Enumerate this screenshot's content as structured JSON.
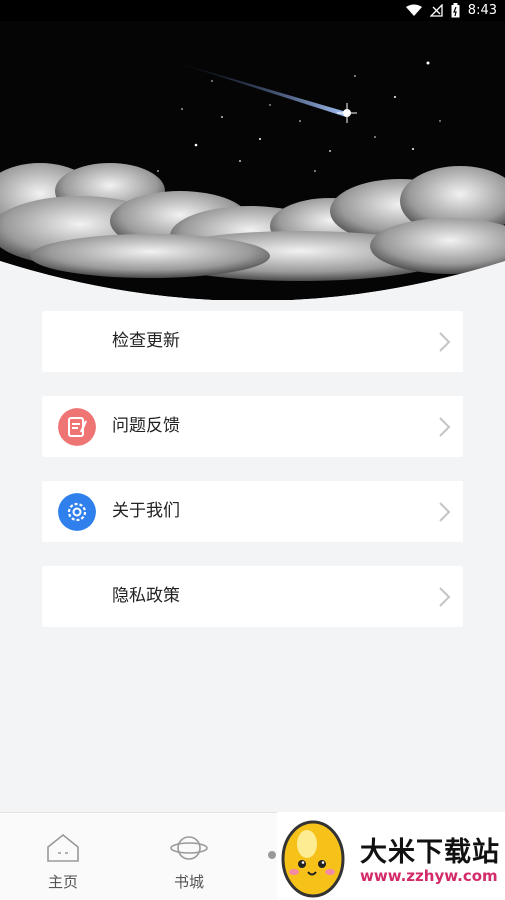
{
  "status_bar": {
    "time": "8:43"
  },
  "menu": {
    "items": [
      {
        "label": "检查更新",
        "icon": "none"
      },
      {
        "label": "问题反馈",
        "icon": "feedback-note-icon",
        "color": "#ef7474"
      },
      {
        "label": "关于我们",
        "icon": "gear-icon",
        "color": "#2f80ed"
      },
      {
        "label": "隐私政策",
        "icon": "none"
      }
    ]
  },
  "bottom_nav": {
    "items": [
      {
        "label": "主页",
        "icon": "home-icon"
      },
      {
        "label": "书城",
        "icon": "planet-icon"
      }
    ]
  },
  "watermark": {
    "brand": "大米下载站",
    "url": "www.zzhyw.com"
  },
  "colors": {
    "background": "#f3f4f6",
    "card": "#ffffff",
    "header_sky": "#050505"
  }
}
